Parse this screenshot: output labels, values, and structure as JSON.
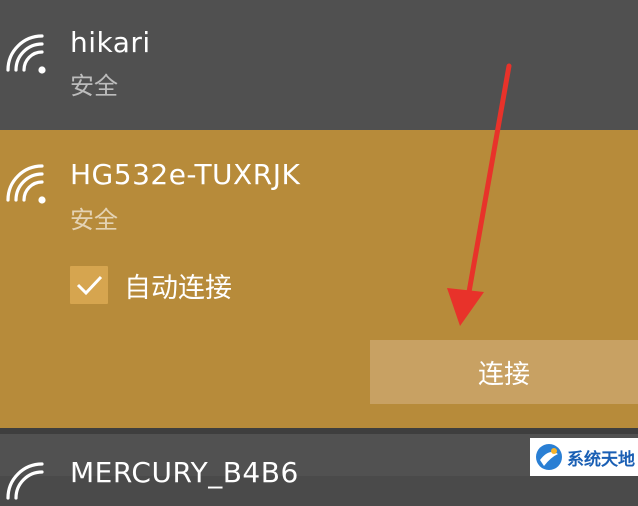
{
  "networks": [
    {
      "name": "hikari",
      "status": "安全",
      "icon": "wifi-icon"
    },
    {
      "name": "HG532e-TUXRJK",
      "status": "安全",
      "icon": "wifi-icon",
      "auto_connect": {
        "label": "自动连接",
        "checked": true
      },
      "connect_label": "连接"
    },
    {
      "name": "MERCURY_B4B6",
      "icon": "wifi-icon"
    }
  ],
  "watermark": {
    "text": "系统天地",
    "icon": "logo-icon"
  },
  "colors": {
    "selected_bg": "#b78b3a",
    "list_bg": "#4a4a4a",
    "arrow": "#e8322a"
  }
}
